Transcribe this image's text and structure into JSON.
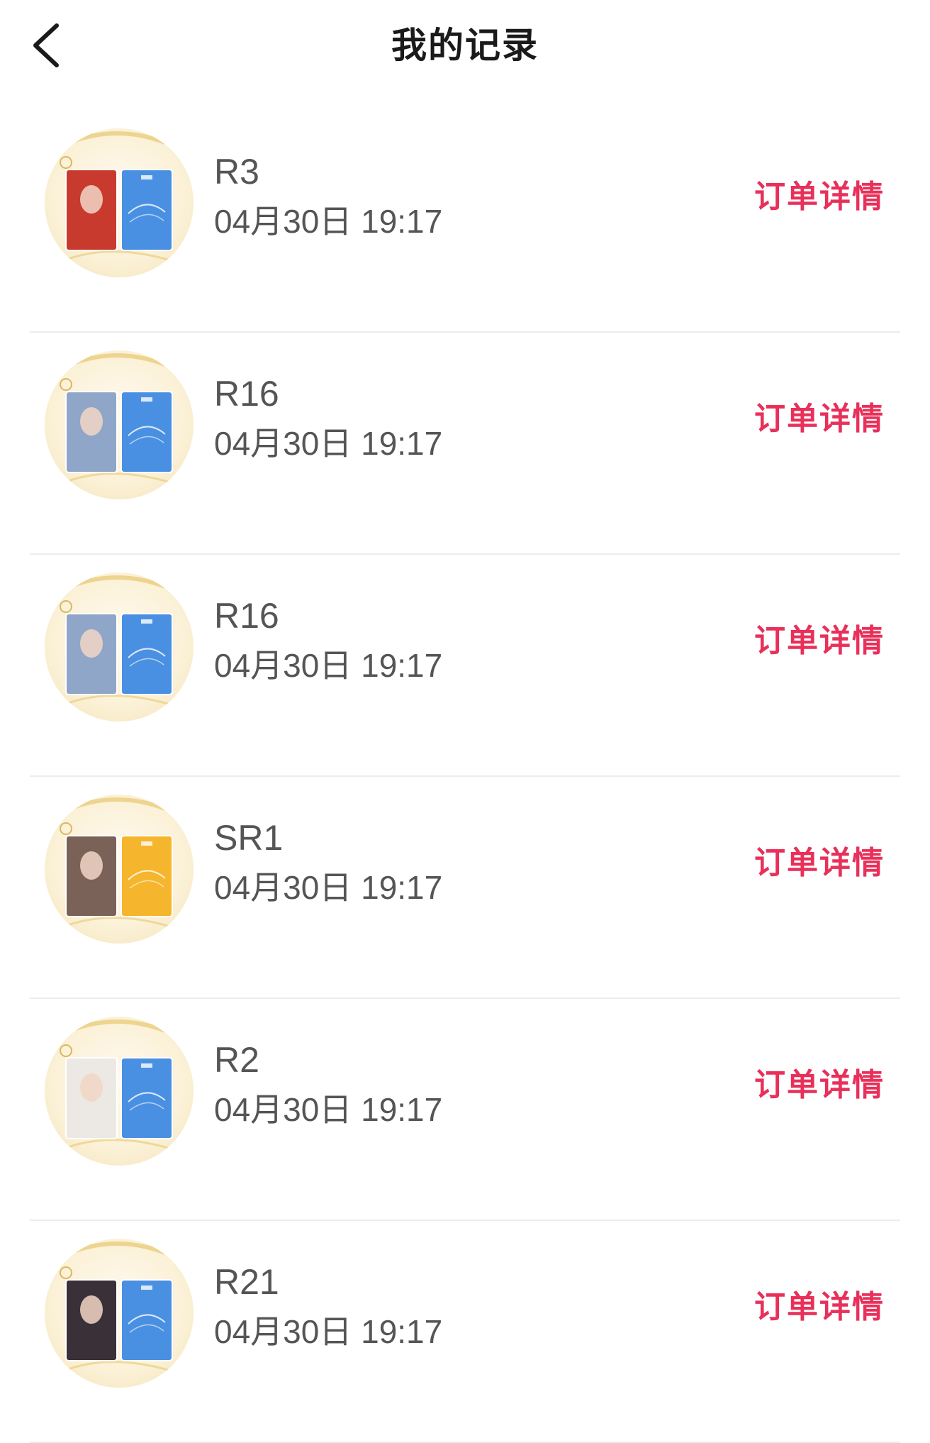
{
  "header": {
    "title": "我的记录"
  },
  "colors": {
    "accent": "#e8305a",
    "card_blue": "#4a90e2",
    "card_yellow": "#f5b52c"
  },
  "records": [
    {
      "name": "R3",
      "time": "04月30日 19:17",
      "action": "订单详情",
      "photo_tone": "#c93a2e",
      "card": "blue"
    },
    {
      "name": "R16",
      "time": "04月30日 19:17",
      "action": "订单详情",
      "photo_tone": "#8fa6c8",
      "card": "blue"
    },
    {
      "name": "R16",
      "time": "04月30日 19:17",
      "action": "订单详情",
      "photo_tone": "#8fa6c8",
      "card": "blue"
    },
    {
      "name": "SR1",
      "time": "04月30日 19:17",
      "action": "订单详情",
      "photo_tone": "#7a6258",
      "card": "yellow"
    },
    {
      "name": "R2",
      "time": "04月30日 19:17",
      "action": "订单详情",
      "photo_tone": "#ece8e4",
      "card": "blue"
    },
    {
      "name": "R21",
      "time": "04月30日 19:17",
      "action": "订单详情",
      "photo_tone": "#3a3038",
      "card": "blue"
    }
  ]
}
